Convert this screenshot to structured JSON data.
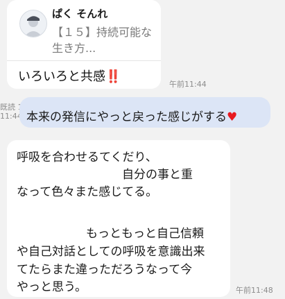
{
  "message1": {
    "reply_author": "ぱく そんれ",
    "reply_preview": "【１５】持続可能な生き方...",
    "text": "いろいろと共感",
    "emoji": "‼️",
    "time": "午前11:44"
  },
  "message2": {
    "read_label": "既読 1",
    "time": "11:44",
    "text": "本来の発信にやっと戻った感じがする",
    "emoji": "♥"
  },
  "message3": {
    "lines": [
      "呼吸を合わせるてくだり、",
      "自分の事と重",
      "なって色々また感じてる。",
      "もっともっと自己信頼",
      "や自己対話としての呼吸を意識出来",
      "てたらまた違っただろうなって今",
      "やっと思う。"
    ],
    "time": "午前11:48"
  }
}
